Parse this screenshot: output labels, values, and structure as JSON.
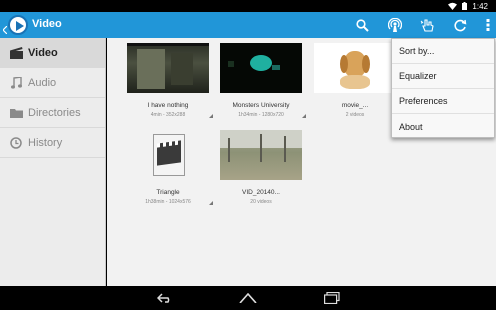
{
  "status_bar": {
    "time": "1:42"
  },
  "app": {
    "title": "Video"
  },
  "toolbar": {
    "icons": [
      "search-icon",
      "wifi-stream-icon",
      "hand-touch-icon",
      "refresh-icon",
      "overflow-menu-icon"
    ],
    "accent": "#2196d8"
  },
  "sidebar": {
    "items": [
      {
        "label": "Video",
        "icon": "film-icon",
        "active": true
      },
      {
        "label": "Audio",
        "icon": "music-note-icon",
        "active": false
      },
      {
        "label": "Directories",
        "icon": "folder-icon",
        "active": false
      },
      {
        "label": "History",
        "icon": "clock-icon",
        "active": false
      }
    ]
  },
  "videos": [
    {
      "title": "I have nothing",
      "meta": "4min - 352x288"
    },
    {
      "title": "Monsters University",
      "meta": "1h34min - 1280x720"
    },
    {
      "title": "movie_...",
      "meta": "2 videos"
    },
    {
      "title": "Triangle",
      "meta": "1h38min - 1024x576"
    },
    {
      "title": "VID_20140...",
      "meta": "20 videos"
    }
  ],
  "menu": {
    "items": [
      "Sort by...",
      "Equalizer",
      "Preferences",
      "About"
    ]
  },
  "nav": {
    "icons": [
      "back-icon",
      "home-icon",
      "recents-icon"
    ]
  }
}
